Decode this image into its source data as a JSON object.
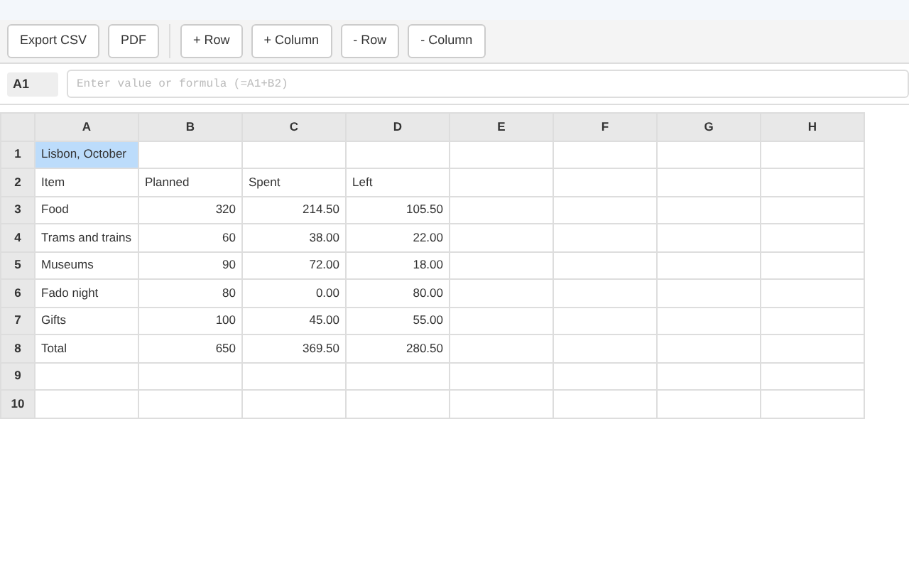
{
  "toolbar": {
    "groups": [
      {
        "buttons": [
          "Export CSV",
          "PDF"
        ]
      },
      {
        "buttons": [
          "+ Row",
          "+ Column",
          "- Row",
          "- Column"
        ]
      }
    ]
  },
  "formula_bar": {
    "cell_ref": "A1",
    "placeholder": "Enter value or formula (=A1+B2)"
  },
  "sheet": {
    "columns": [
      "A",
      "B",
      "C",
      "D",
      "E",
      "F",
      "G",
      "H"
    ],
    "rows": [
      {
        "header": "1",
        "cells": [
          {
            "text": "Lisbon, October",
            "kind": "text",
            "selected": true
          },
          {
            "selected": false
          },
          {
            "selected": false
          },
          {
            "selected": false
          },
          {
            "selected": false
          },
          {
            "selected": false
          },
          {
            "selected": false
          },
          {
            "selected": false
          }
        ]
      },
      {
        "header": "2",
        "cells": [
          {
            "text": "Item",
            "kind": "text",
            "selected": false
          },
          {
            "text": "Planned",
            "kind": "text",
            "selected": false
          },
          {
            "text": "Spent",
            "kind": "text",
            "selected": false
          },
          {
            "text": "Left",
            "kind": "text",
            "selected": false
          },
          {
            "selected": false
          },
          {
            "selected": false
          },
          {
            "selected": false
          },
          {
            "selected": false
          }
        ]
      },
      {
        "header": "3",
        "cells": [
          {
            "text": "Food",
            "kind": "text",
            "selected": false
          },
          {
            "text": "320",
            "kind": "number",
            "selected": false
          },
          {
            "text": "214.50",
            "kind": "number",
            "selected": false
          },
          {
            "text": "105.50",
            "kind": "number",
            "selected": false
          },
          {
            "selected": false
          },
          {
            "selected": false
          },
          {
            "selected": false
          },
          {
            "selected": false
          }
        ]
      },
      {
        "header": "4",
        "cells": [
          {
            "text": "Trams and trains",
            "kind": "text",
            "selected": false
          },
          {
            "text": "60",
            "kind": "number",
            "selected": false
          },
          {
            "text": "38.00",
            "kind": "number",
            "selected": false
          },
          {
            "text": "22.00",
            "kind": "number",
            "selected": false
          },
          {
            "selected": false
          },
          {
            "selected": false
          },
          {
            "selected": false
          },
          {
            "selected": false
          }
        ]
      },
      {
        "header": "5",
        "cells": [
          {
            "text": "Museums",
            "kind": "text",
            "selected": false
          },
          {
            "text": "90",
            "kind": "number",
            "selected": false
          },
          {
            "text": "72.00",
            "kind": "number",
            "selected": false
          },
          {
            "text": "18.00",
            "kind": "number",
            "selected": false
          },
          {
            "selected": false
          },
          {
            "selected": false
          },
          {
            "selected": false
          },
          {
            "selected": false
          }
        ]
      },
      {
        "header": "6",
        "cells": [
          {
            "text": "Fado night",
            "kind": "text",
            "selected": false
          },
          {
            "text": "80",
            "kind": "number",
            "selected": false
          },
          {
            "text": "0.00",
            "kind": "number",
            "selected": false
          },
          {
            "text": "80.00",
            "kind": "number",
            "selected": false
          },
          {
            "selected": false
          },
          {
            "selected": false
          },
          {
            "selected": false
          },
          {
            "selected": false
          }
        ]
      },
      {
        "header": "7",
        "cells": [
          {
            "text": "Gifts",
            "kind": "text",
            "selected": false
          },
          {
            "text": "100",
            "kind": "number",
            "selected": false
          },
          {
            "text": "45.00",
            "kind": "number",
            "selected": false
          },
          {
            "text": "55.00",
            "kind": "number",
            "selected": false
          },
          {
            "selected": false
          },
          {
            "selected": false
          },
          {
            "selected": false
          },
          {
            "selected": false
          }
        ]
      },
      {
        "header": "8",
        "cells": [
          {
            "text": "Total",
            "kind": "text",
            "selected": false
          },
          {
            "text": "650",
            "kind": "number",
            "selected": false
          },
          {
            "text": "369.50",
            "kind": "number",
            "selected": false
          },
          {
            "text": "280.50",
            "kind": "number",
            "selected": false
          },
          {
            "selected": false
          },
          {
            "selected": false
          },
          {
            "selected": false
          },
          {
            "selected": false
          }
        ]
      },
      {
        "header": "9",
        "cells": [
          {
            "selected": false
          },
          {
            "selected": false
          },
          {
            "selected": false
          },
          {
            "selected": false
          },
          {
            "selected": false
          },
          {
            "selected": false
          },
          {
            "selected": false
          },
          {
            "selected": false
          }
        ]
      },
      {
        "header": "10",
        "cells": [
          {
            "selected": false
          },
          {
            "selected": false
          },
          {
            "selected": false
          },
          {
            "selected": false
          },
          {
            "selected": false
          },
          {
            "selected": false
          },
          {
            "selected": false
          },
          {
            "selected": false
          }
        ]
      }
    ]
  }
}
